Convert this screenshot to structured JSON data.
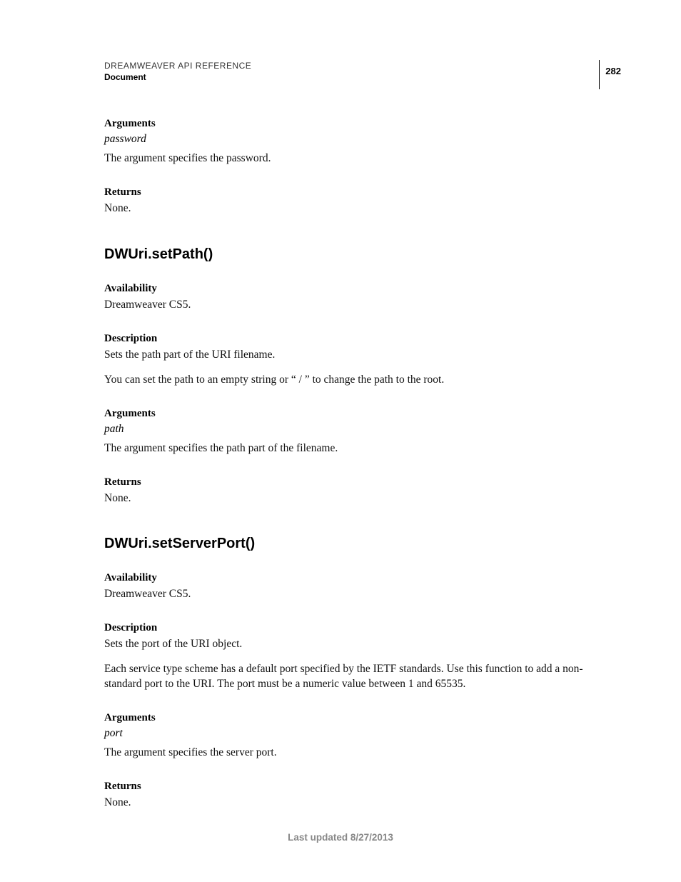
{
  "header": {
    "title": "DREAMWEAVER API REFERENCE",
    "section": "Document",
    "page_number": "282"
  },
  "s0": {
    "arguments_label": "Arguments",
    "arg_name": "password",
    "arg_desc": "The argument specifies the password.",
    "returns_label": "Returns",
    "returns_value": "None."
  },
  "s1": {
    "title": "DWUri.setPath()",
    "availability_label": "Availability",
    "availability_value": "Dreamweaver CS5.",
    "description_label": "Description",
    "description_value1": "Sets the path part of the URI filename.",
    "description_value2": "You can set the path to an empty string or “ / ” to change the path to the root.",
    "arguments_label": "Arguments",
    "arg_name": "path",
    "arg_desc": "The argument specifies the path part of the filename.",
    "returns_label": "Returns",
    "returns_value": "None."
  },
  "s2": {
    "title": "DWUri.setServerPort()",
    "availability_label": "Availability",
    "availability_value": "Dreamweaver CS5.",
    "description_label": "Description",
    "description_value1": "Sets the port of the URI object.",
    "description_value2": "Each service type scheme has a default port specified by the IETF standards. Use this function to add a non-standard port to the URI. The port must be a numeric value between 1 and 65535.",
    "arguments_label": "Arguments",
    "arg_name": "port",
    "arg_desc": "The argument specifies the server port.",
    "returns_label": "Returns",
    "returns_value": "None."
  },
  "footer": {
    "text": "Last updated 8/27/2013"
  }
}
